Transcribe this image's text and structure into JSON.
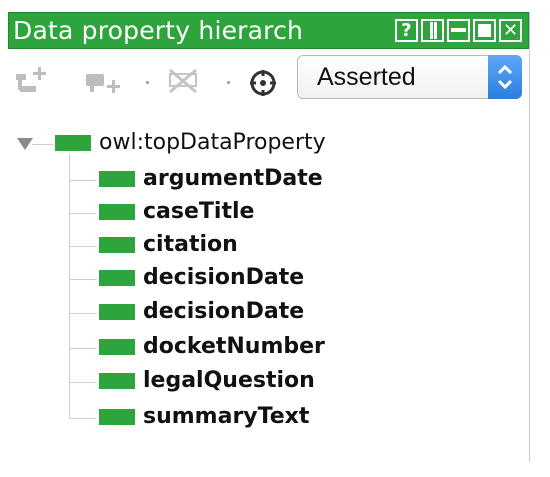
{
  "window": {
    "title": "Data property hierarch",
    "buttons": [
      {
        "name": "help-button",
        "glyph": "?"
      },
      {
        "name": "split-button",
        "glyph": ""
      },
      {
        "name": "minimize-button",
        "glyph": ""
      },
      {
        "name": "maximize-button",
        "glyph": ""
      },
      {
        "name": "close-button",
        "glyph": "✕"
      }
    ]
  },
  "toolbar": {
    "icons": [
      "add-subproperty-icon",
      "add-sibling-property-icon",
      "delete-property-icon",
      "target-icon"
    ],
    "view_select": {
      "selected": "Asserted"
    }
  },
  "tree": {
    "root": {
      "label": "owl:topDataProperty",
      "expanded": true
    },
    "children": [
      "argumentDate",
      "caseTitle",
      "citation",
      "decisionDate",
      "decisionDate",
      "docketNumber",
      "legalQuestion",
      "summaryText"
    ]
  },
  "colors": {
    "title_bar": "#2ea43c",
    "entity_box": "#2ea43c",
    "select_stepper": "#2b7fe0"
  }
}
